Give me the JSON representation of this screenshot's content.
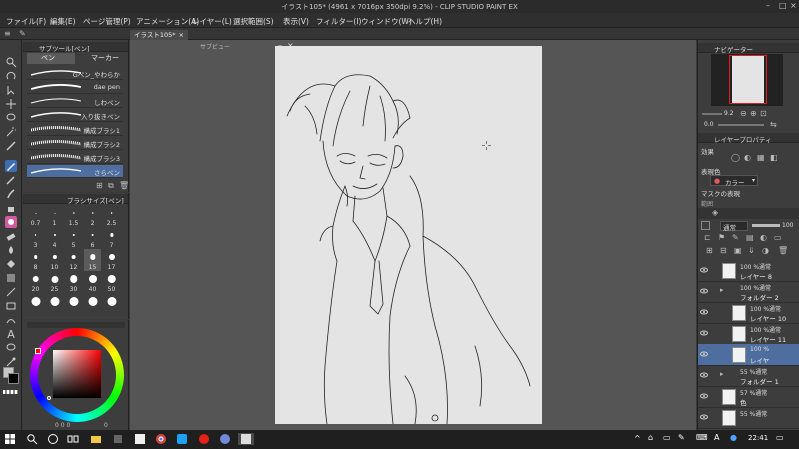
{
  "window": {
    "title": "イラスト105* (4961 x 7016px 350dpi 9.2%) - CLIP STUDIO PAINT EX"
  },
  "menu": [
    "ファイル(F)",
    "編集(E)",
    "ページ管理(P)",
    "アニメーション(A)",
    "レイヤー(L)",
    "選択範囲(S)",
    "表示(V)",
    "フィルター(I)",
    "ウィンドウ(W)",
    "ヘルプ(H)"
  ],
  "doc_tab": "イラスト105*",
  "preview_label": "サブビュー",
  "subtool": {
    "header": "サブツール[ペン]",
    "tabs": [
      "ペン",
      "マーカー"
    ],
    "brushes": [
      "Gペン_やわらか",
      "dae pen",
      "しわペン",
      "入り抜きペン",
      "構成ブラシ1",
      "構成ブラシ2",
      "構成ブラシ3",
      "さらペン"
    ]
  },
  "brushsize": {
    "header": "ブラシサイズ[ペン]",
    "sizes": [
      "0.7",
      "1",
      "1.5",
      "2",
      "2.5",
      "3",
      "4",
      "5",
      "6",
      "7",
      "8",
      "10",
      "12",
      "15",
      "17",
      "20",
      "25",
      "30",
      "40",
      "50",
      "",
      "",
      "",
      "",
      ""
    ],
    "selected_index": 13
  },
  "color": {
    "counter": "0 0 0",
    "value_right": "0"
  },
  "navigator": {
    "header": "ナビゲーター",
    "zoom": "9.2",
    "rotate": "0.0"
  },
  "layer_property": {
    "header": "レイヤープロパティ",
    "effect_label": "効果",
    "expression_label": "表現色",
    "expression_value": "カラー",
    "mask_label": "マスクの表現",
    "partial_label": "範囲"
  },
  "layers_panel": {
    "blend_mode": "通常",
    "opacity": "100",
    "rows": [
      {
        "top": "100 %通常",
        "name": "レイヤー 8",
        "indent": 0
      },
      {
        "top": "100 %通常",
        "name": "フォルダー 2",
        "indent": 0,
        "folder": true
      },
      {
        "top": "100 %通常",
        "name": "レイヤー 10",
        "indent": 1
      },
      {
        "top": "100 %通常",
        "name": "レイヤー 11",
        "indent": 1
      },
      {
        "top": "100 %",
        "name": "レイヤ",
        "indent": 1,
        "selected": true
      },
      {
        "top": "55 %通常",
        "name": "フォルダー 1",
        "indent": 0,
        "folder": true
      },
      {
        "top": "57 %通常",
        "name": "色",
        "indent": 0
      },
      {
        "top": "55 %通常",
        "name": "",
        "indent": 0
      }
    ]
  },
  "taskbar": {
    "time": "22:41",
    "ime": "A"
  },
  "colors": {
    "accent": "#4d6e9e",
    "canvas_bg": "#555555",
    "paper": "#e4e4e4"
  }
}
